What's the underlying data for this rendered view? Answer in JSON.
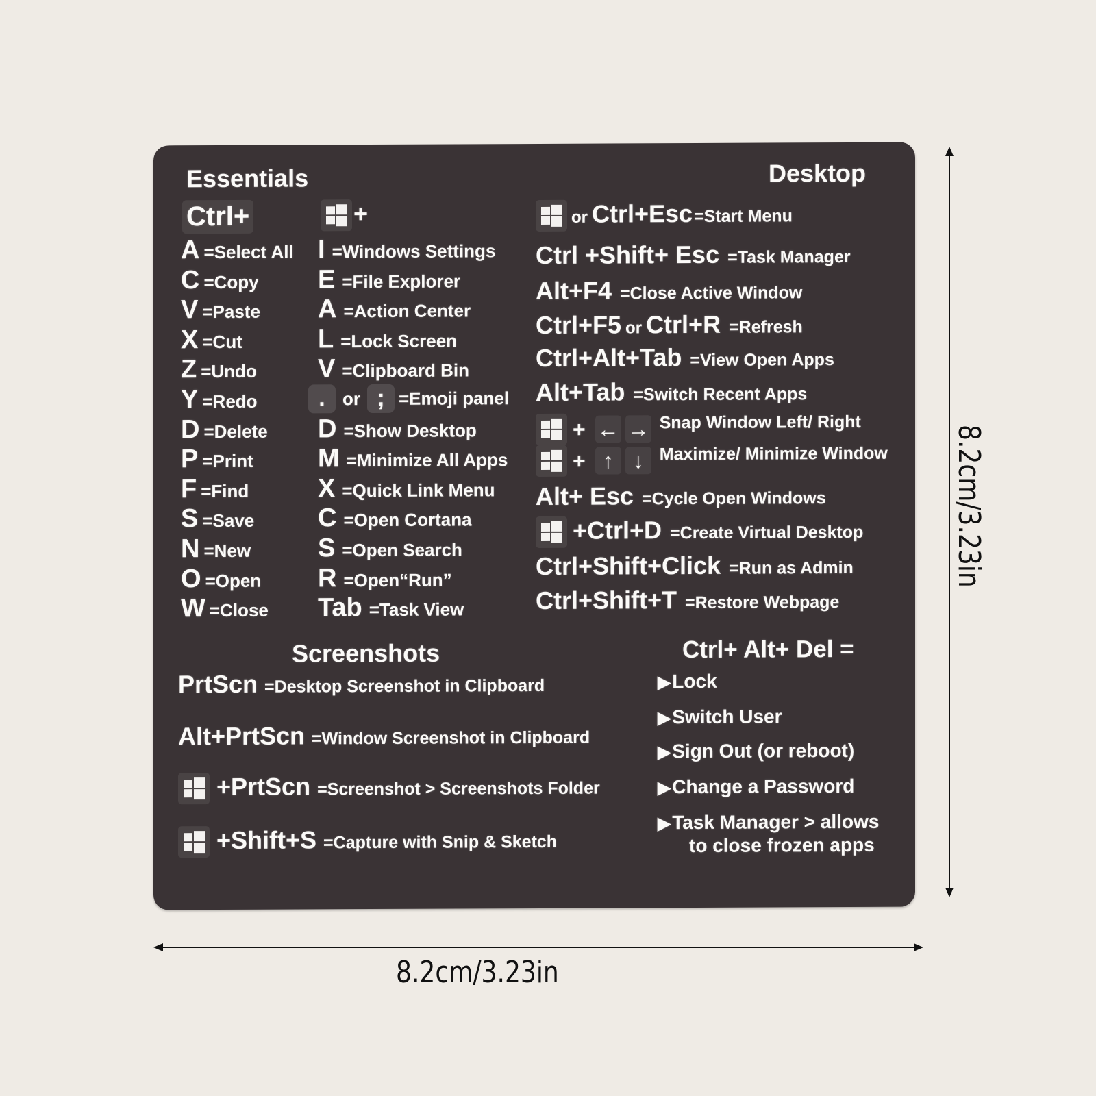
{
  "sections": {
    "essentials": {
      "title": "Essentials",
      "ctrl_header": "Ctrl+",
      "win_header_suffix": "+",
      "ctrl_shortcuts": [
        {
          "key": "A",
          "action": "=Select All"
        },
        {
          "key": "C",
          "action": "=Copy"
        },
        {
          "key": "V",
          "action": "=Paste"
        },
        {
          "key": "X",
          "action": "=Cut"
        },
        {
          "key": "Z",
          "action": "=Undo"
        },
        {
          "key": "Y",
          "action": "=Redo"
        },
        {
          "key": "D",
          "action": "=Delete"
        },
        {
          "key": "P",
          "action": "=Print"
        },
        {
          "key": "F",
          "action": "=Find"
        },
        {
          "key": "S",
          "action": "=Save"
        },
        {
          "key": "N",
          "action": "=New"
        },
        {
          "key": "O",
          "action": "=Open"
        },
        {
          "key": "W",
          "action": "=Close"
        }
      ],
      "win_shortcuts": [
        {
          "key": "I",
          "action": "=Windows Settings"
        },
        {
          "key": "E",
          "action": "=File Explorer"
        },
        {
          "key": "A",
          "action": "=Action Center"
        },
        {
          "key": "L",
          "action": "=Lock Screen"
        },
        {
          "key": "V",
          "action": "=Clipboard Bin"
        },
        {
          "key": "",
          "action": "=Emoji panel",
          "emoji_keys": [
            ".",
            ";"
          ],
          "or": "or"
        },
        {
          "key": "D",
          "action": "=Show Desktop"
        },
        {
          "key": "M",
          "action": "=Minimize All Apps"
        },
        {
          "key": "X",
          "action": "=Quick Link Menu"
        },
        {
          "key": "C",
          "action": "=Open Cortana"
        },
        {
          "key": "S",
          "action": "=Open Search"
        },
        {
          "key": "R",
          "action": "=Open“Run”"
        },
        {
          "key": "Tab",
          "action": "=Task View"
        }
      ]
    },
    "desktop": {
      "title": "Desktop",
      "shortcuts": [
        {
          "prefix_or": "or",
          "key": "Ctrl+Esc",
          "action": "=Start Menu"
        },
        {
          "key": "Ctrl +Shift+ Esc",
          "action": "=Task Manager"
        },
        {
          "key": "Alt+F4",
          "action": "=Close Active Window"
        },
        {
          "key": "Ctrl+F5",
          "or": "or",
          "key2": "Ctrl+R",
          "action": "=Refresh"
        },
        {
          "key": "Ctrl+Alt+Tab",
          "action": "=View Open Apps"
        },
        {
          "key": "Alt+Tab",
          "action": "=Switch Recent Apps"
        },
        {
          "plus": "+",
          "arrows": [
            "←",
            "→"
          ],
          "action": "Snap Window Left/ Right"
        },
        {
          "plus": "+",
          "arrows": [
            "↑",
            "↓"
          ],
          "action": "Maximize/ Minimize Window"
        },
        {
          "key": "Alt+ Esc",
          "action": "=Cycle Open Windows"
        },
        {
          "key": "+Ctrl+D",
          "action": "=Create Virtual Desktop"
        },
        {
          "key": "Ctrl+Shift+Click",
          "action": "=Run as Admin"
        },
        {
          "key": "Ctrl+Shift+T",
          "action": "=Restore Webpage"
        }
      ]
    },
    "screenshots": {
      "title": "Screenshots",
      "shortcuts": [
        {
          "key": "PrtScn",
          "action": "=Desktop Screenshot in Clipboard"
        },
        {
          "key": "Alt+PrtScn",
          "action": "=Window Screenshot in Clipboard"
        },
        {
          "key": "+PrtScn",
          "action": "=Screenshot > Screenshots Folder"
        },
        {
          "key": "+Shift+S",
          "action": "=Capture with Snip & Sketch"
        }
      ]
    },
    "ctrl_alt_del": {
      "title": "Ctrl+ Alt+ Del =",
      "bullet": "▶",
      "items": [
        "Lock",
        "Switch User",
        "Sign Out (or reboot)",
        "Change a Password",
        "Task Manager > allows"
      ],
      "last_item_continuation": "to close frozen apps"
    }
  },
  "dimensions": {
    "width_label": "8.2cm/3.23in",
    "height_label": "8.2cm/3.23in"
  },
  "icons": {
    "windows_key": "windows-logo-icon",
    "bullet": "play-triangle-icon"
  }
}
